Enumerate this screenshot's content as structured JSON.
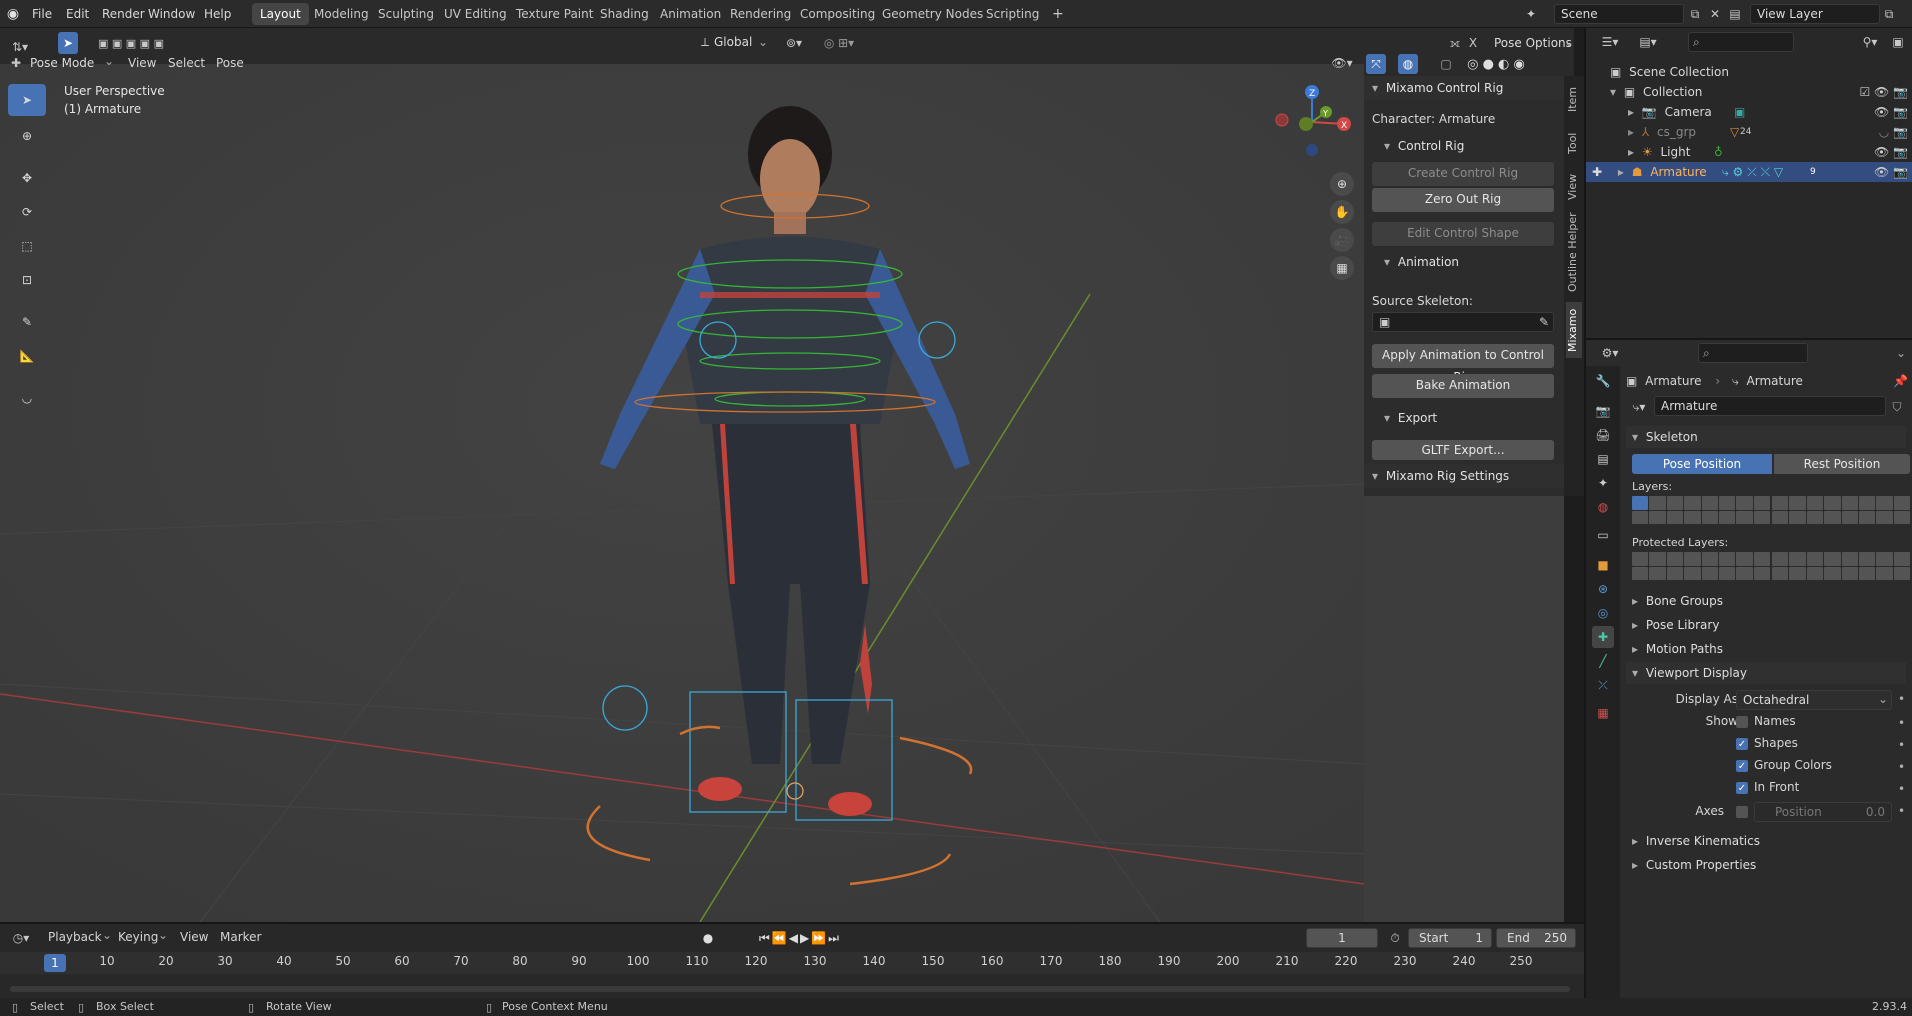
{
  "menubar": {
    "items": [
      "File",
      "Edit",
      "Render",
      "Window",
      "Help"
    ],
    "workspaces": [
      "Layout",
      "Modeling",
      "Sculpting",
      "UV Editing",
      "Texture Paint",
      "Shading",
      "Animation",
      "Rendering",
      "Compositing",
      "Geometry Nodes",
      "Scripting"
    ],
    "active_workspace": "Layout",
    "scene": "Scene",
    "view_layer": "View Layer"
  },
  "viewport_header": {
    "mode": "Pose Mode",
    "menus": [
      "View",
      "Select",
      "Pose"
    ],
    "orientation": "Global",
    "pose_options": "Pose Options"
  },
  "viewport": {
    "view_name": "User Perspective",
    "object_label": "(1) Armature"
  },
  "npanel": {
    "title": "Mixamo Control Rig",
    "character": "Character: Armature",
    "control_rig_header": "Control Rig",
    "create_control_rig": "Create Control Rig",
    "zero_out_rig": "Zero Out Rig",
    "edit_control_shape": "Edit Control Shape",
    "animation_header": "Animation",
    "source_skeleton": "Source Skeleton:",
    "apply_animation": "Apply Animation to Control Rig",
    "bake_animation": "Bake Animation",
    "export_header": "Export",
    "gltf_export": "GLTF Export...",
    "rig_settings": "Mixamo Rig Settings",
    "tabs": [
      "Item",
      "Tool",
      "View",
      "Outline Helper",
      "Mixamo"
    ]
  },
  "outliner": {
    "root": "Scene Collection",
    "collection": "Collection",
    "items": [
      {
        "name": "Camera"
      },
      {
        "name": "cs_grp",
        "count": "24"
      },
      {
        "name": "Light"
      },
      {
        "name": "Armature",
        "count": "9"
      }
    ]
  },
  "properties": {
    "breadcrumb_object": "Armature",
    "breadcrumb_data": "Armature",
    "data_name": "Armature",
    "skeleton": "Skeleton",
    "pose_position": "Pose Position",
    "rest_position": "Rest Position",
    "layers": "Layers:",
    "protected_layers": "Protected Layers:",
    "bone_groups": "Bone Groups",
    "pose_library": "Pose Library",
    "motion_paths": "Motion Paths",
    "viewport_display": "Viewport Display",
    "display_as_label": "Display As",
    "display_as_value": "Octahedral",
    "show_label": "Show",
    "names": "Names",
    "shapes": "Shapes",
    "group_colors": "Group Colors",
    "in_front": "In Front",
    "axes": "Axes",
    "position": "Position",
    "position_value": "0.0",
    "inverse_kinematics": "Inverse Kinematics",
    "custom_properties": "Custom Properties"
  },
  "timeline": {
    "menus": [
      "Playback",
      "Keying",
      "View",
      "Marker"
    ],
    "current_frame": "1",
    "start_label": "Start",
    "start_value": "1",
    "end_label": "End",
    "end_value": "250",
    "ticks": [
      "1",
      "10",
      "20",
      "30",
      "40",
      "50",
      "60",
      "70",
      "80",
      "90",
      "100",
      "110",
      "120",
      "130",
      "140",
      "150",
      "160",
      "170",
      "180",
      "190",
      "200",
      "210",
      "220",
      "230",
      "240",
      "250"
    ]
  },
  "statusbar": {
    "select": "Select",
    "box_select": "Box Select",
    "rotate_view": "Rotate View",
    "context_menu": "Pose Context Menu",
    "version": "2.93.4"
  },
  "colors": {
    "accent": "#4772b3",
    "selection": "#334d80",
    "viewport_bg": "#3d3d3d"
  }
}
